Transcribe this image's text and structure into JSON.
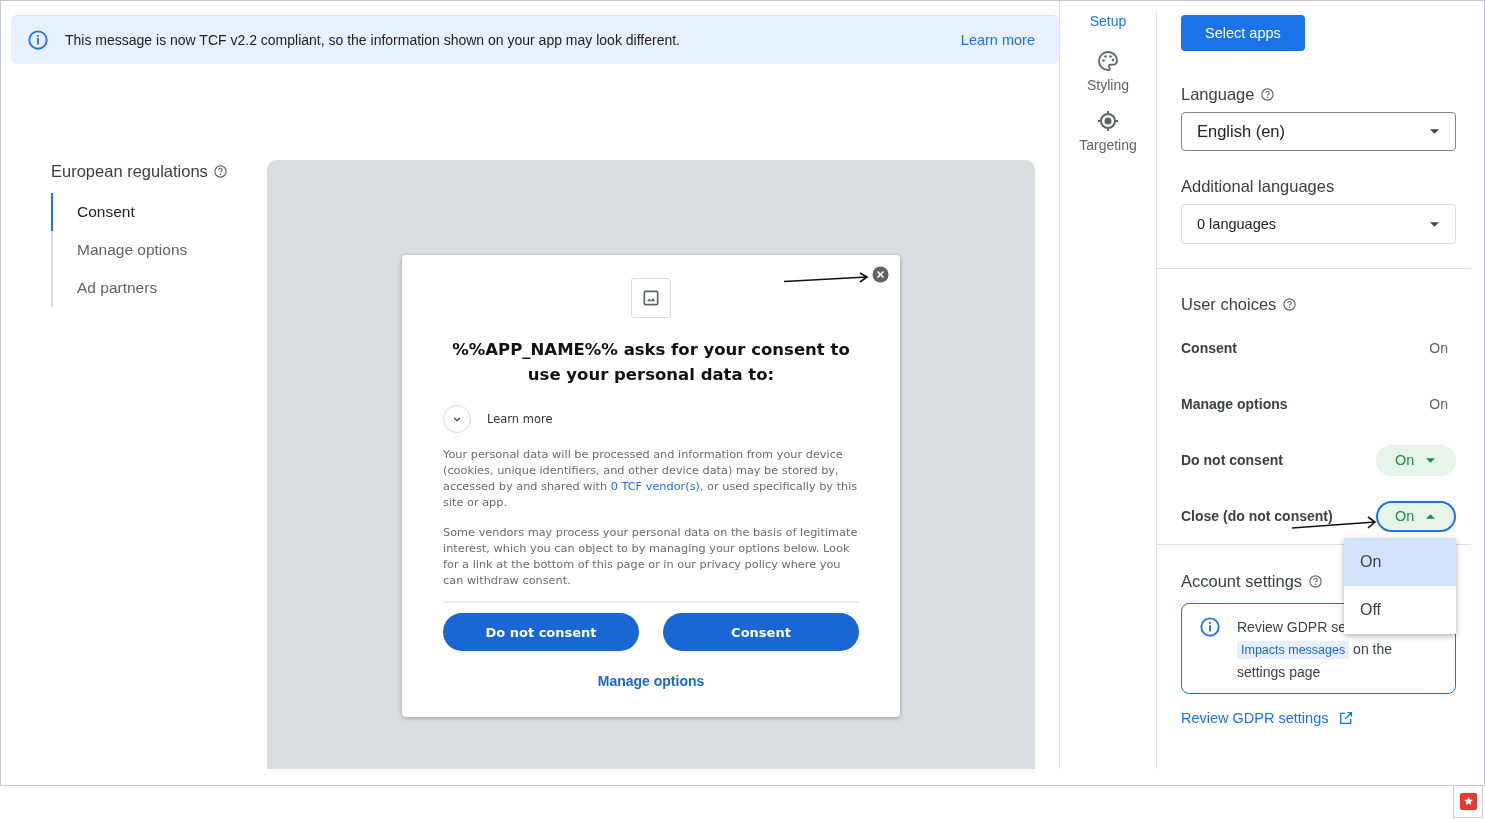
{
  "banner": {
    "text": "This message is now TCF v2.2 compliant, so the information shown on your app may look different.",
    "link": "Learn more"
  },
  "regulations": {
    "title": "European regulations",
    "items": [
      {
        "label": "Consent",
        "selected": true
      },
      {
        "label": "Manage options",
        "selected": false
      },
      {
        "label": "Ad partners",
        "selected": false
      }
    ]
  },
  "dialog": {
    "title": "%%APP_NAME%% asks for your consent to use your personal data to:",
    "learn_more": "Learn more",
    "paragraph_1": {
      "before": "Your personal data will be processed and information from your device (cookies, unique identifiers, and other device data) may be stored by, accessed by and shared with",
      "link": "0 TCF vendor(s)",
      "after": ", or used specifically by this site or app."
    },
    "paragraph_2": "Some vendors may process your personal data on the basis of legitimate interest, which you can object to by managing your options below. Look for a link at the bottom of this page or in our privacy policy where you can withdraw consent.",
    "buttons": [
      "Do not consent",
      "Consent"
    ],
    "manage_options": "Manage options"
  },
  "rail": [
    {
      "label": "Setup",
      "selected": true
    },
    {
      "label": "Styling",
      "selected": false
    },
    {
      "label": "Targeting",
      "selected": false
    }
  ],
  "select_apps": "Select apps",
  "language": {
    "label": "Language",
    "value": "English (en)"
  },
  "additional_languages": {
    "label": "Additional languages",
    "value": "0 languages"
  },
  "user_choices": {
    "title": "User choices",
    "rows": [
      {
        "label": "Consent",
        "value": "On",
        "kind": "static"
      },
      {
        "label": "Manage options",
        "value": "On",
        "kind": "static"
      },
      {
        "label": "Do not consent",
        "value": "On",
        "kind": "dropdown",
        "expanded": false
      },
      {
        "label": "Close (do not consent)",
        "value": "On",
        "kind": "dropdown",
        "expanded": true
      }
    ]
  },
  "menu": [
    {
      "label": "On",
      "selected": true
    },
    {
      "label": "Off",
      "selected": false
    }
  ],
  "account_settings": {
    "title": "Account settings",
    "info": {
      "before": "Review GDPR se",
      "link": "Impacts messages",
      "after": "on the settings page"
    },
    "link": "Review GDPR settings"
  }
}
